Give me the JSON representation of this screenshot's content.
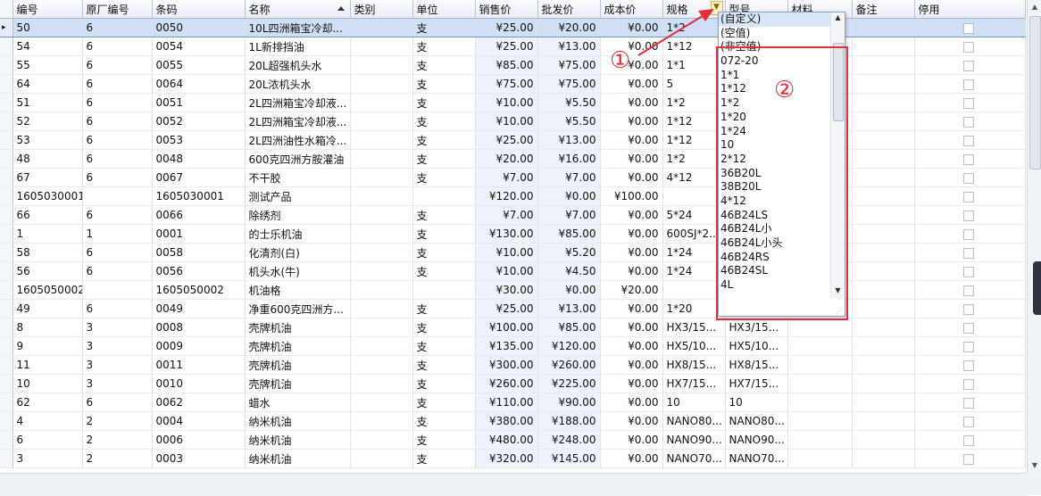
{
  "columns": [
    "编号",
    "原厂编号",
    "条码",
    "名称",
    "类别",
    "单位",
    "销售价",
    "批发价",
    "成本价",
    "规格",
    "型号",
    "材料",
    "备注",
    "停用"
  ],
  "rows": [
    [
      "50",
      "6",
      "0050",
      "10L四洲箱宝冷却...",
      "",
      "支",
      "¥25.00",
      "¥20.00",
      "¥0.00",
      "1*2",
      "",
      "",
      ""
    ],
    [
      "54",
      "6",
      "0054",
      "1L新排挡油",
      "",
      "支",
      "¥25.00",
      "¥13.00",
      "¥0.00",
      "1*12",
      "",
      "",
      ""
    ],
    [
      "55",
      "6",
      "0055",
      "20L超强机头水",
      "",
      "支",
      "¥85.00",
      "¥75.00",
      "¥0.00",
      "1*1",
      "",
      "",
      ""
    ],
    [
      "64",
      "6",
      "0064",
      "20L浓机头水",
      "",
      "支",
      "¥75.00",
      "¥75.00",
      "¥0.00",
      "5",
      "",
      "",
      ""
    ],
    [
      "51",
      "6",
      "0051",
      "2L四洲箱宝冷却液...",
      "",
      "支",
      "¥10.00",
      "¥5.50",
      "¥0.00",
      "1*2",
      "",
      "",
      ""
    ],
    [
      "52",
      "6",
      "0052",
      "2L四洲箱宝冷却液...",
      "",
      "支",
      "¥10.00",
      "¥5.50",
      "¥0.00",
      "1*12",
      "",
      "",
      ""
    ],
    [
      "53",
      "6",
      "0053",
      "2L四洲油性水箱冷...",
      "",
      "支",
      "¥25.00",
      "¥13.00",
      "¥0.00",
      "1*12",
      "",
      "",
      ""
    ],
    [
      "48",
      "6",
      "0048",
      "600克四洲方胺灌油",
      "",
      "支",
      "¥20.00",
      "¥16.00",
      "¥0.00",
      "1*2",
      "",
      "",
      ""
    ],
    [
      "67",
      "6",
      "0067",
      "不干胶",
      "",
      "支",
      "¥7.00",
      "¥7.00",
      "¥0.00",
      "4*12",
      "",
      "",
      ""
    ],
    [
      "1605030001",
      "",
      "1605030001",
      "测试产品",
      "",
      "",
      "¥120.00",
      "¥0.00",
      "¥100.00",
      "",
      "",
      "",
      ""
    ],
    [
      "66",
      "6",
      "0066",
      "除绣剂",
      "",
      "支",
      "¥7.00",
      "¥7.00",
      "¥0.00",
      "5*24",
      "",
      "",
      ""
    ],
    [
      "1",
      "1",
      "0001",
      "的士乐机油",
      "",
      "支",
      "¥130.00",
      "¥85.00",
      "¥0.00",
      "600SJ*2...",
      "",
      "",
      ""
    ],
    [
      "58",
      "6",
      "0058",
      "化清剂(白)",
      "",
      "支",
      "¥10.00",
      "¥5.20",
      "¥0.00",
      "1*24",
      "",
      "",
      ""
    ],
    [
      "56",
      "6",
      "0056",
      "机头水(牛)",
      "",
      "支",
      "¥10.00",
      "¥4.50",
      "¥0.00",
      "1*24",
      "",
      "",
      ""
    ],
    [
      "1605050002",
      "",
      "1605050002",
      "机油格",
      "",
      "",
      "¥30.00",
      "¥0.00",
      "¥20.00",
      "",
      "",
      "",
      ""
    ],
    [
      "49",
      "6",
      "0049",
      "净重600克四洲方...",
      "",
      "支",
      "¥25.00",
      "¥13.00",
      "¥0.00",
      "1*20",
      "",
      "",
      ""
    ],
    [
      "8",
      "3",
      "0008",
      "壳牌机油",
      "",
      "支",
      "¥100.00",
      "¥85.00",
      "¥0.00",
      "HX3/15...",
      "HX3/15...",
      "",
      ""
    ],
    [
      "9",
      "3",
      "0009",
      "壳牌机油",
      "",
      "支",
      "¥135.00",
      "¥120.00",
      "¥0.00",
      "HX5/10...",
      "HX5/10...",
      "",
      ""
    ],
    [
      "11",
      "3",
      "0011",
      "壳牌机油",
      "",
      "支",
      "¥300.00",
      "¥260.00",
      "¥0.00",
      "HX8/15...",
      "HX8/15...",
      "",
      ""
    ],
    [
      "10",
      "3",
      "0010",
      "壳牌机油",
      "",
      "支",
      "¥260.00",
      "¥225.00",
      "¥0.00",
      "HX7/15...",
      "HX7/15...",
      "",
      ""
    ],
    [
      "62",
      "6",
      "0062",
      "蜡水",
      "",
      "支",
      "¥110.00",
      "¥90.00",
      "¥0.00",
      "10",
      "10",
      "",
      ""
    ],
    [
      "4",
      "2",
      "0004",
      "纳米机油",
      "",
      "支",
      "¥380.00",
      "¥188.00",
      "¥0.00",
      "NANO80...",
      "NANO80...",
      "",
      ""
    ],
    [
      "6",
      "2",
      "0006",
      "纳米机油",
      "",
      "支",
      "¥480.00",
      "¥248.00",
      "¥0.00",
      "NANO90...",
      "NANO90...",
      "",
      ""
    ],
    [
      "3",
      "2",
      "0003",
      "纳米机油",
      "",
      "支",
      "¥320.00",
      "¥145.00",
      "¥0.00",
      "NANO70...",
      "NANO70...",
      "",
      ""
    ]
  ],
  "filter_dropdown": {
    "items": [
      "(自定义)",
      "(空值)",
      "(非空值)",
      "072-20",
      "1*1",
      "1*12",
      "1*2",
      "1*20",
      "1*24",
      "10",
      "2*12",
      "36B20L",
      "38B20L",
      "4*12",
      "46B24LS",
      "46B24L小",
      "46B24L小头",
      "46B24RS",
      "46B24SL",
      "4L"
    ],
    "highlighted_index": 0,
    "filter_icon": "filter-funnel-icon"
  },
  "annotations": {
    "one": "①",
    "two": "②"
  },
  "colors": {
    "annotation": "#e0303a",
    "selected_row": "#cfe0f5",
    "price_bg": "#eef3fb"
  }
}
